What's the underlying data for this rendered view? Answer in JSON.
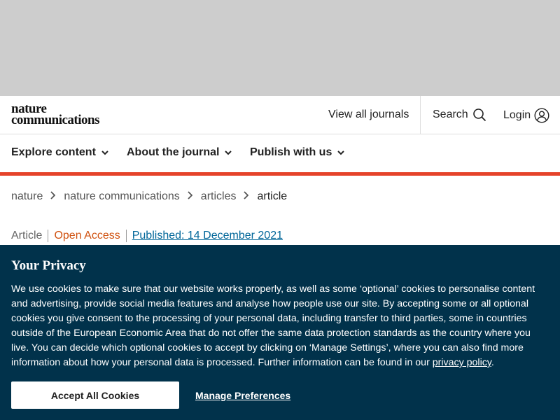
{
  "brand": {
    "line1": "nature",
    "line2": "communications"
  },
  "header": {
    "view_all": "View all journals",
    "search": "Search",
    "login": "Login"
  },
  "nav": {
    "items": [
      {
        "label": "Explore content"
      },
      {
        "label": "About the journal"
      },
      {
        "label": "Publish with us"
      }
    ]
  },
  "breadcrumb": [
    "nature",
    "nature communications",
    "articles",
    "article"
  ],
  "article_meta": {
    "type": "Article",
    "access": "Open Access",
    "published": "Published: 14 December 2021"
  },
  "cookie_banner": {
    "title": "Your Privacy",
    "text": "We use cookies to make sure that our website works properly, as well as some ‘optional’ cookies to personalise content and advertising, provide social media features and analyse how people use our site. By accepting some or all optional cookies you give consent to the processing of your personal data, including transfer to third parties, some in countries outside of the European Economic Area that do not offer the same data protection standards as the country where you live. You can decide which optional cookies to accept by clicking on ‘Manage Settings’, where you can also find more information about how your personal data is processed. Further information can be found in our",
    "privacy_link": "privacy policy",
    "trailing": ".",
    "accept_label": "Accept All Cookies",
    "manage_label": "Manage Preferences"
  },
  "colors": {
    "accent_red": "#e5432a",
    "banner_bg": "#01324b",
    "open_access": "#d0510f",
    "link_blue": "#006699"
  }
}
